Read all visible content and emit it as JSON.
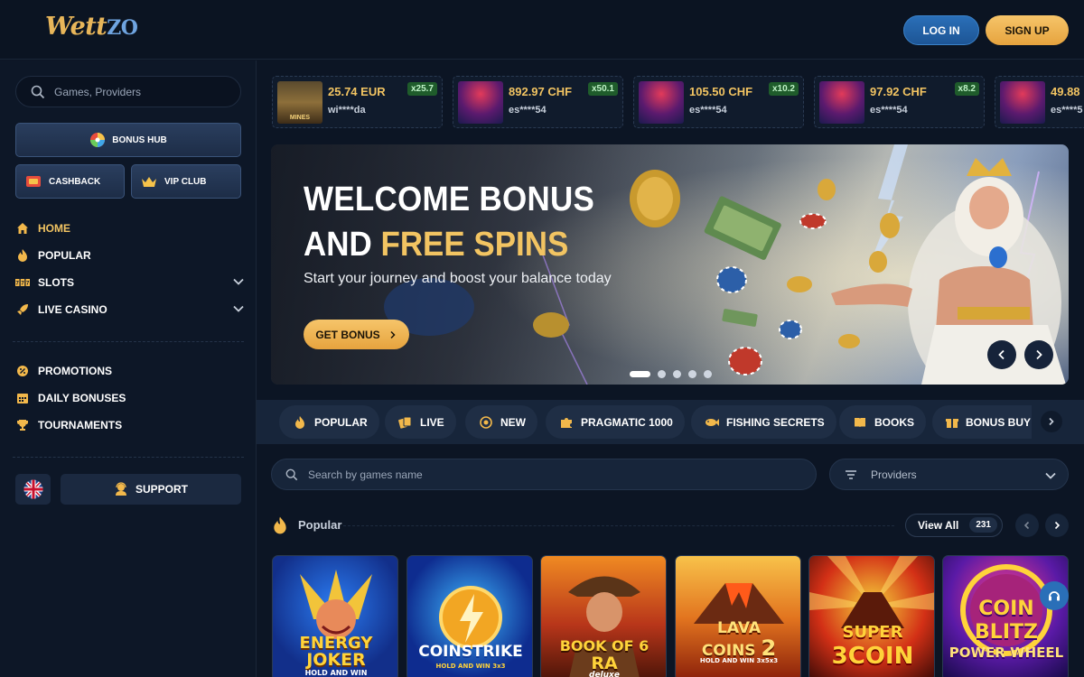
{
  "header": {
    "logo_main": "Wett",
    "logo_accent": "ZO",
    "login_label": "LOG IN",
    "signup_label": "SIGN UP"
  },
  "sidebar": {
    "search_placeholder": "Games, Providers",
    "bonus_hub": "BONUS HUB",
    "cashback": "CASHBACK",
    "vip_club": "VIP CLUB",
    "nav": [
      {
        "label": "HOME",
        "icon": "home-icon",
        "active": true
      },
      {
        "label": "POPULAR",
        "icon": "fire-icon"
      },
      {
        "label": "SLOTS",
        "icon": "slots-icon",
        "expandable": true
      },
      {
        "label": "LIVE CASINO",
        "icon": "rocket-icon",
        "expandable": true
      }
    ],
    "nav2": [
      {
        "label": "PROMOTIONS",
        "icon": "promo-icon"
      },
      {
        "label": "DAILY BONUSES",
        "icon": "calendar-icon"
      },
      {
        "label": "TOURNAMENTS",
        "icon": "trophy-icon"
      }
    ],
    "support": "SUPPORT",
    "language_flag": "uk-flag-icon"
  },
  "wins": [
    {
      "amount": "25.74 EUR",
      "user": "wi****da",
      "multiplier": "x25.7",
      "thumb_text": "MINES"
    },
    {
      "amount": "892.97 CHF",
      "user": "es****54",
      "multiplier": "x50.1"
    },
    {
      "amount": "105.50 CHF",
      "user": "es****54",
      "multiplier": "x10.2"
    },
    {
      "amount": "97.92 CHF",
      "user": "es****54",
      "multiplier": "x8.2"
    },
    {
      "amount": "49.88",
      "user": "es****5",
      "multiplier": ""
    }
  ],
  "hero": {
    "title_line1": "WELCOME BONUS",
    "title_line2_white": "AND ",
    "title_line2_gold": "FREE SPINS",
    "subtitle": "Start your journey and boost your balance today",
    "cta": "GET BONUS",
    "slides": 5,
    "active_slide": 1
  },
  "categories": [
    {
      "label": "POPULAR",
      "icon": "fire-icon"
    },
    {
      "label": "LIVE",
      "icon": "cards-icon"
    },
    {
      "label": "NEW",
      "icon": "new-icon"
    },
    {
      "label": "PRAGMATIC 1000",
      "icon": "puzzle-icon"
    },
    {
      "label": "FISHING SECRETS",
      "icon": "fish-icon"
    },
    {
      "label": "BOOKS",
      "icon": "book-icon"
    },
    {
      "label": "BONUS BUY",
      "icon": "gift-icon"
    }
  ],
  "games_search_placeholder": "Search by games name",
  "providers_label": "Providers",
  "popular": {
    "title": "Popular",
    "view_all": "View All",
    "count": "231"
  },
  "games": [
    {
      "line1": "ENERGY",
      "line2": "JOKER",
      "line3": "HOLD AND WIN"
    },
    {
      "line1": "COIN",
      "line2": "STRIKE",
      "line3": "HOLD AND WIN 3x3"
    },
    {
      "line1": "BOOK OF",
      "line2": "RA",
      "line3": "deluxe",
      "num": "6"
    },
    {
      "line1": "LAVA",
      "line2": "COINS",
      "line3": "HOLD AND WIN 3x5x3",
      "num": "2"
    },
    {
      "line1": "SUPER",
      "line2": "3COIN",
      "line3": ""
    },
    {
      "line1": "COIN",
      "line2": "BLITZ",
      "line3": "POWER WHEEL"
    }
  ],
  "colors": {
    "bg": "#0c1524",
    "gold": "#f2c462",
    "blue_button": "#2a6fb8",
    "multiplier_green": "#1f5c2b"
  }
}
